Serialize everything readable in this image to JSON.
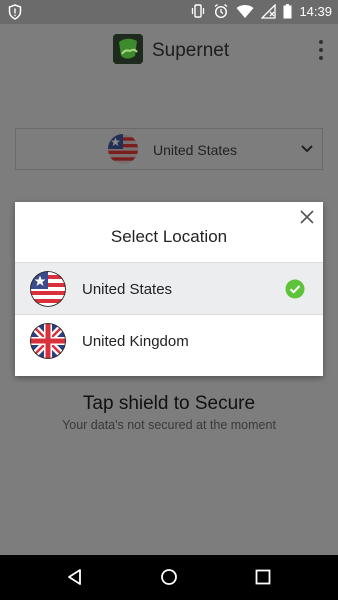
{
  "status_bar": {
    "time": "14:39",
    "icons": [
      "shield-alert-icon",
      "vibrate-icon",
      "alarm-icon",
      "wifi-icon",
      "no-signal-icon",
      "battery-icon"
    ]
  },
  "app_bar": {
    "title": "Supernet",
    "logo_icon": "supernet-logo-icon",
    "menu_icon": "overflow-menu-icon"
  },
  "background": {
    "selected_location": "United States",
    "tap_title": "Tap shield to Secure",
    "tap_subtitle": "Your data's not secured at the moment"
  },
  "dialog": {
    "title": "Select Location",
    "close_icon": "close-icon",
    "locations": [
      {
        "label": "United States",
        "flag_icon": "us-flag-icon",
        "selected": true
      },
      {
        "label": "United Kingdom",
        "flag_icon": "uk-flag-icon",
        "selected": false
      }
    ]
  },
  "colors": {
    "scrim": "#7d7d7d",
    "selected_row": "#ecedef",
    "check_green": "#5cc33a",
    "nav_bar": "#000000"
  },
  "nav_bar": {
    "icons": [
      "back-icon",
      "home-icon",
      "recents-icon"
    ]
  }
}
